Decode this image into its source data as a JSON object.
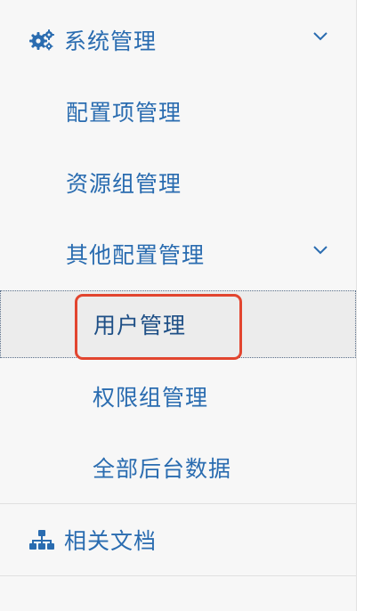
{
  "menu": {
    "system": {
      "label": "系统管理",
      "icon": "gears-icon",
      "children": [
        {
          "label": "配置项管理"
        },
        {
          "label": "资源组管理"
        }
      ],
      "other": {
        "label": "其他配置管理",
        "children": [
          {
            "label": "用户管理",
            "selected": true
          },
          {
            "label": "权限组管理"
          },
          {
            "label": "全部后台数据"
          }
        ]
      }
    },
    "docs": {
      "label": "相关文档",
      "icon": "sitemap-icon"
    }
  },
  "colors": {
    "text": "#2a6cb0",
    "highlight": "#e2452f",
    "background": "#f7f7f7"
  }
}
